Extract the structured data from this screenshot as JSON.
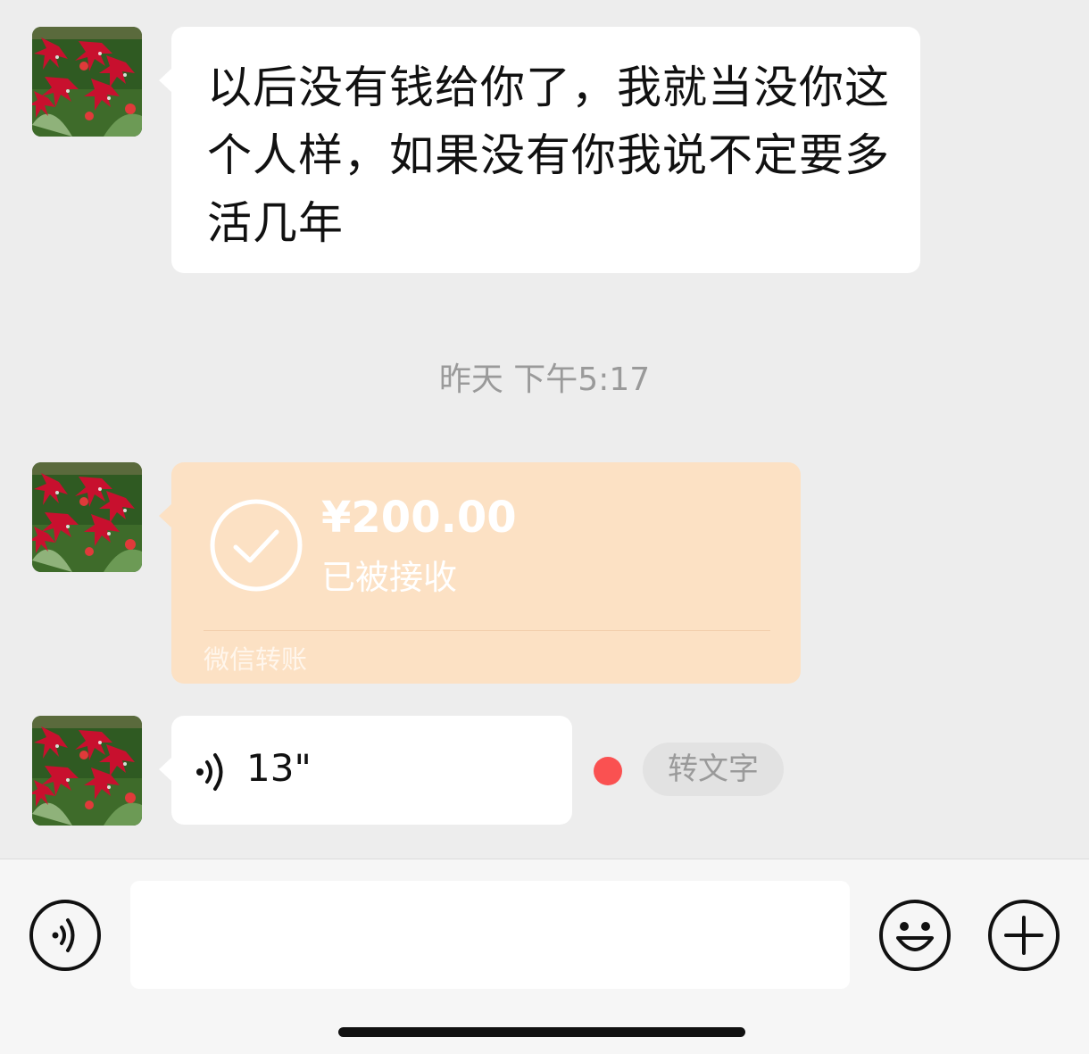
{
  "messages": {
    "text": "以后没有钱给你了，我就当没你这个人样，如果没有你我说不定要多活几年",
    "timestamp": "昨天 下午5:17",
    "transfer": {
      "amount": "¥200.00",
      "status": "已被接收",
      "label": "微信转账"
    },
    "voice": {
      "duration": "13\"",
      "to_text_button": "转文字"
    }
  },
  "colors": {
    "background": "#ededed",
    "transfer_bubble": "#fce1c4",
    "unread_dot": "#fa5151"
  },
  "icons": {
    "avatar": "red-flowers-avatar",
    "transfer": "check-circle-icon",
    "voice_message": "voice-wave-icon",
    "voice_toggle": "voice-input-icon",
    "emoji": "emoji-smile-icon",
    "more": "plus-circle-icon"
  }
}
